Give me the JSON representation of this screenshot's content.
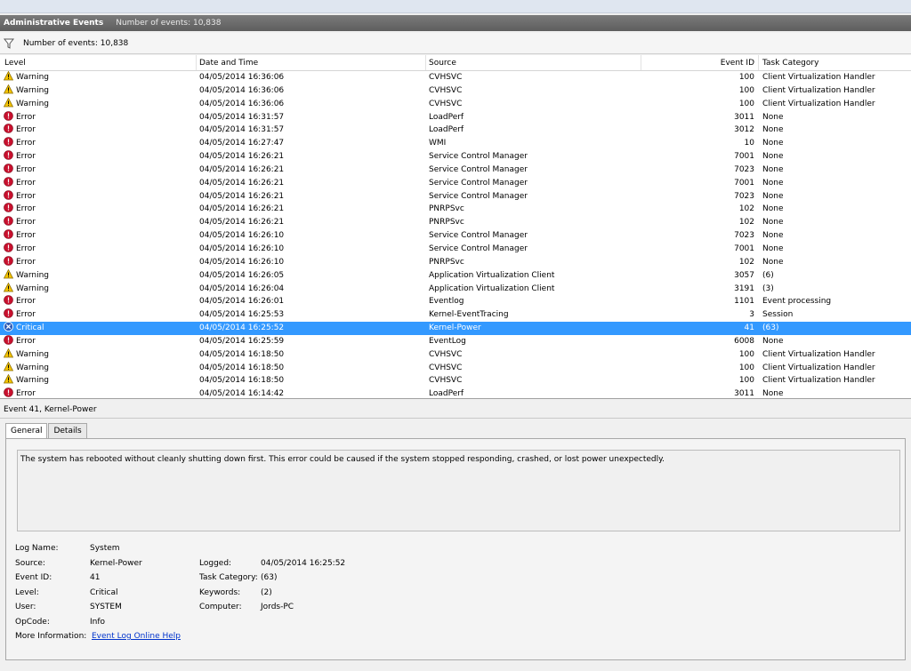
{
  "panel": {
    "title": "Administrative Events",
    "count_label": "Number of events: 10,838"
  },
  "filter": {
    "count_label": "Number of events: 10,838"
  },
  "columns": [
    "Level",
    "Date and Time",
    "Source",
    "Event ID",
    "Task Category"
  ],
  "events": [
    {
      "level": "Warning",
      "date": "04/05/2014 16:36:06",
      "source": "CVHSVC",
      "id": "100",
      "category": "Client Virtualization Handler"
    },
    {
      "level": "Warning",
      "date": "04/05/2014 16:36:06",
      "source": "CVHSVC",
      "id": "100",
      "category": "Client Virtualization Handler"
    },
    {
      "level": "Warning",
      "date": "04/05/2014 16:36:06",
      "source": "CVHSVC",
      "id": "100",
      "category": "Client Virtualization Handler"
    },
    {
      "level": "Error",
      "date": "04/05/2014 16:31:57",
      "source": "LoadPerf",
      "id": "3011",
      "category": "None"
    },
    {
      "level": "Error",
      "date": "04/05/2014 16:31:57",
      "source": "LoadPerf",
      "id": "3012",
      "category": "None"
    },
    {
      "level": "Error",
      "date": "04/05/2014 16:27:47",
      "source": "WMI",
      "id": "10",
      "category": "None"
    },
    {
      "level": "Error",
      "date": "04/05/2014 16:26:21",
      "source": "Service Control Manager",
      "id": "7001",
      "category": "None"
    },
    {
      "level": "Error",
      "date": "04/05/2014 16:26:21",
      "source": "Service Control Manager",
      "id": "7023",
      "category": "None"
    },
    {
      "level": "Error",
      "date": "04/05/2014 16:26:21",
      "source": "Service Control Manager",
      "id": "7001",
      "category": "None"
    },
    {
      "level": "Error",
      "date": "04/05/2014 16:26:21",
      "source": "Service Control Manager",
      "id": "7023",
      "category": "None"
    },
    {
      "level": "Error",
      "date": "04/05/2014 16:26:21",
      "source": "PNRPSvc",
      "id": "102",
      "category": "None"
    },
    {
      "level": "Error",
      "date": "04/05/2014 16:26:21",
      "source": "PNRPSvc",
      "id": "102",
      "category": "None"
    },
    {
      "level": "Error",
      "date": "04/05/2014 16:26:10",
      "source": "Service Control Manager",
      "id": "7023",
      "category": "None"
    },
    {
      "level": "Error",
      "date": "04/05/2014 16:26:10",
      "source": "Service Control Manager",
      "id": "7001",
      "category": "None"
    },
    {
      "level": "Error",
      "date": "04/05/2014 16:26:10",
      "source": "PNRPSvc",
      "id": "102",
      "category": "None"
    },
    {
      "level": "Warning",
      "date": "04/05/2014 16:26:05",
      "source": "Application Virtualization Client",
      "id": "3057",
      "category": "(6)"
    },
    {
      "level": "Warning",
      "date": "04/05/2014 16:26:04",
      "source": "Application Virtualization Client",
      "id": "3191",
      "category": "(3)"
    },
    {
      "level": "Error",
      "date": "04/05/2014 16:26:01",
      "source": "Eventlog",
      "id": "1101",
      "category": "Event processing"
    },
    {
      "level": "Error",
      "date": "04/05/2014 16:25:53",
      "source": "Kernel-EventTracing",
      "id": "3",
      "category": "Session"
    },
    {
      "level": "Critical",
      "date": "04/05/2014 16:25:52",
      "source": "Kernel-Power",
      "id": "41",
      "category": "(63)",
      "selected": true
    },
    {
      "level": "Error",
      "date": "04/05/2014 16:25:59",
      "source": "EventLog",
      "id": "6008",
      "category": "None"
    },
    {
      "level": "Warning",
      "date": "04/05/2014 16:18:50",
      "source": "CVHSVC",
      "id": "100",
      "category": "Client Virtualization Handler"
    },
    {
      "level": "Warning",
      "date": "04/05/2014 16:18:50",
      "source": "CVHSVC",
      "id": "100",
      "category": "Client Virtualization Handler"
    },
    {
      "level": "Warning",
      "date": "04/05/2014 16:18:50",
      "source": "CVHSVC",
      "id": "100",
      "category": "Client Virtualization Handler"
    },
    {
      "level": "Error",
      "date": "04/05/2014 16:14:42",
      "source": "LoadPerf",
      "id": "3011",
      "category": "None"
    }
  ],
  "detail": {
    "header": "Event 41, Kernel-Power",
    "tabs": [
      "General",
      "Details"
    ],
    "description": "The system has rebooted without cleanly shutting down first. This error could be caused if the system stopped responding, crashed, or lost power unexpectedly.",
    "log_name_label": "Log Name:",
    "log_name": "System",
    "source_label": "Source:",
    "source": "Kernel-Power",
    "logged_label": "Logged:",
    "logged": "04/05/2014 16:25:52",
    "event_id_label": "Event ID:",
    "event_id": "41",
    "task_category_label": "Task Category:",
    "task_category": "(63)",
    "level_label": "Level:",
    "level": "Critical",
    "keywords_label": "Keywords:",
    "keywords": "(2)",
    "user_label": "User:",
    "user": "SYSTEM",
    "computer_label": "Computer:",
    "computer": "Jords-PC",
    "opcode_label": "OpCode:",
    "opcode": "Info",
    "more_info_label": "More Information:",
    "more_info_link": "Event Log Online Help"
  },
  "colors": {
    "selection": "#3399ff",
    "warning": "#f5c400",
    "error": "#c8102e",
    "critical": "#2e5cb8",
    "link": "#0033cc"
  }
}
